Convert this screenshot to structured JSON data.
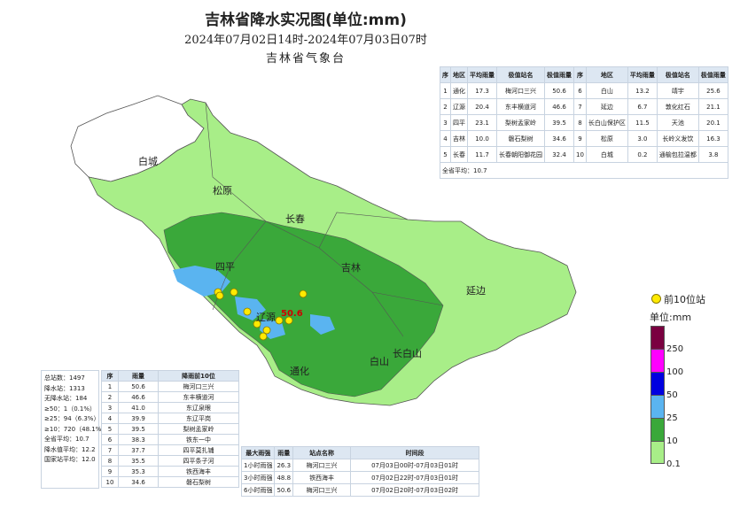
{
  "title": "吉林省降水实况图(单位:mm)",
  "period": "2024年07月02日14时-2024年07月03日07时",
  "agency": "吉林省气象台",
  "cities": [
    "白城",
    "松原",
    "长春",
    "四平",
    "吉林",
    "延边",
    "辽源",
    "通化",
    "白山",
    "长白山"
  ],
  "max_label": "50.6",
  "top_table": {
    "headers": [
      "序",
      "地区",
      "平均雨量",
      "极值站名",
      "极值雨量",
      "序",
      "地区",
      "平均雨量",
      "极值站名",
      "极值雨量"
    ],
    "rows": [
      [
        "1",
        "通化",
        "17.3",
        "梅河口三兴",
        "50.6",
        "6",
        "白山",
        "13.2",
        "靖宇",
        "25.6"
      ],
      [
        "2",
        "辽源",
        "20.4",
        "东丰横道河",
        "46.6",
        "7",
        "延边",
        "6.7",
        "敦化红石",
        "21.1"
      ],
      [
        "3",
        "四平",
        "23.1",
        "梨树孟家岭",
        "39.5",
        "8",
        "长白山保护区",
        "11.5",
        "天池",
        "20.1"
      ],
      [
        "4",
        "吉林",
        "10.0",
        "磐石梨树",
        "34.6",
        "9",
        "松原",
        "3.0",
        "长岭义发饮",
        "16.3"
      ],
      [
        "5",
        "长春",
        "11.7",
        "长春朝阳御花园",
        "32.4",
        "10",
        "白城",
        "0.2",
        "通榆包拉温都",
        "3.8"
      ]
    ],
    "footer": "全省平均：10.7"
  },
  "stats": [
    "总站数：1497",
    "降水站：1313",
    "无降水站：184",
    "≥50：1（0.1%）",
    "≥25：94（6.3%）",
    "≥10：720（48.1%）",
    "全省平均：10.7",
    "降水值平均：12.2",
    "国家站平均：12.0"
  ],
  "top10": {
    "headers": [
      "序",
      "雨量",
      "降雨前10位"
    ],
    "rows": [
      [
        "1",
        "50.6",
        "梅河口三兴"
      ],
      [
        "2",
        "46.6",
        "东丰横道河"
      ],
      [
        "3",
        "41.0",
        "东辽泉眼"
      ],
      [
        "4",
        "39.9",
        "东辽平岗"
      ],
      [
        "5",
        "39.5",
        "梨树孟家岭"
      ],
      [
        "6",
        "38.3",
        "铁东一中"
      ],
      [
        "7",
        "37.7",
        "四平莫扎铺"
      ],
      [
        "8",
        "35.5",
        "四平条子河"
      ],
      [
        "9",
        "35.3",
        "铁西海丰"
      ],
      [
        "10",
        "34.6",
        "磐石梨树"
      ]
    ]
  },
  "max_table": {
    "headers": [
      "最大雨强",
      "雨量",
      "站点名称",
      "时间段"
    ],
    "rows": [
      [
        "1小时雨强",
        "26.3",
        "梅河口三兴",
        "07月03日00时-07月03日01时"
      ],
      [
        "3小时雨强",
        "48.8",
        "铁西海丰",
        "07月02日22时-07月03日01时"
      ],
      [
        "6小时雨强",
        "50.6",
        "梅河口三兴",
        "07月02日20时-07月03日02时"
      ]
    ]
  },
  "legend": {
    "top10_label": "前10位站",
    "unit": "单位:mm",
    "ticks": [
      "250",
      "100",
      "50",
      "25",
      "10",
      "0.1"
    ],
    "colors": [
      "#7a0040",
      "#ff00ff",
      "#0000e0",
      "#5ab4f0",
      "#3aa83a",
      "#a8ee88"
    ]
  }
}
